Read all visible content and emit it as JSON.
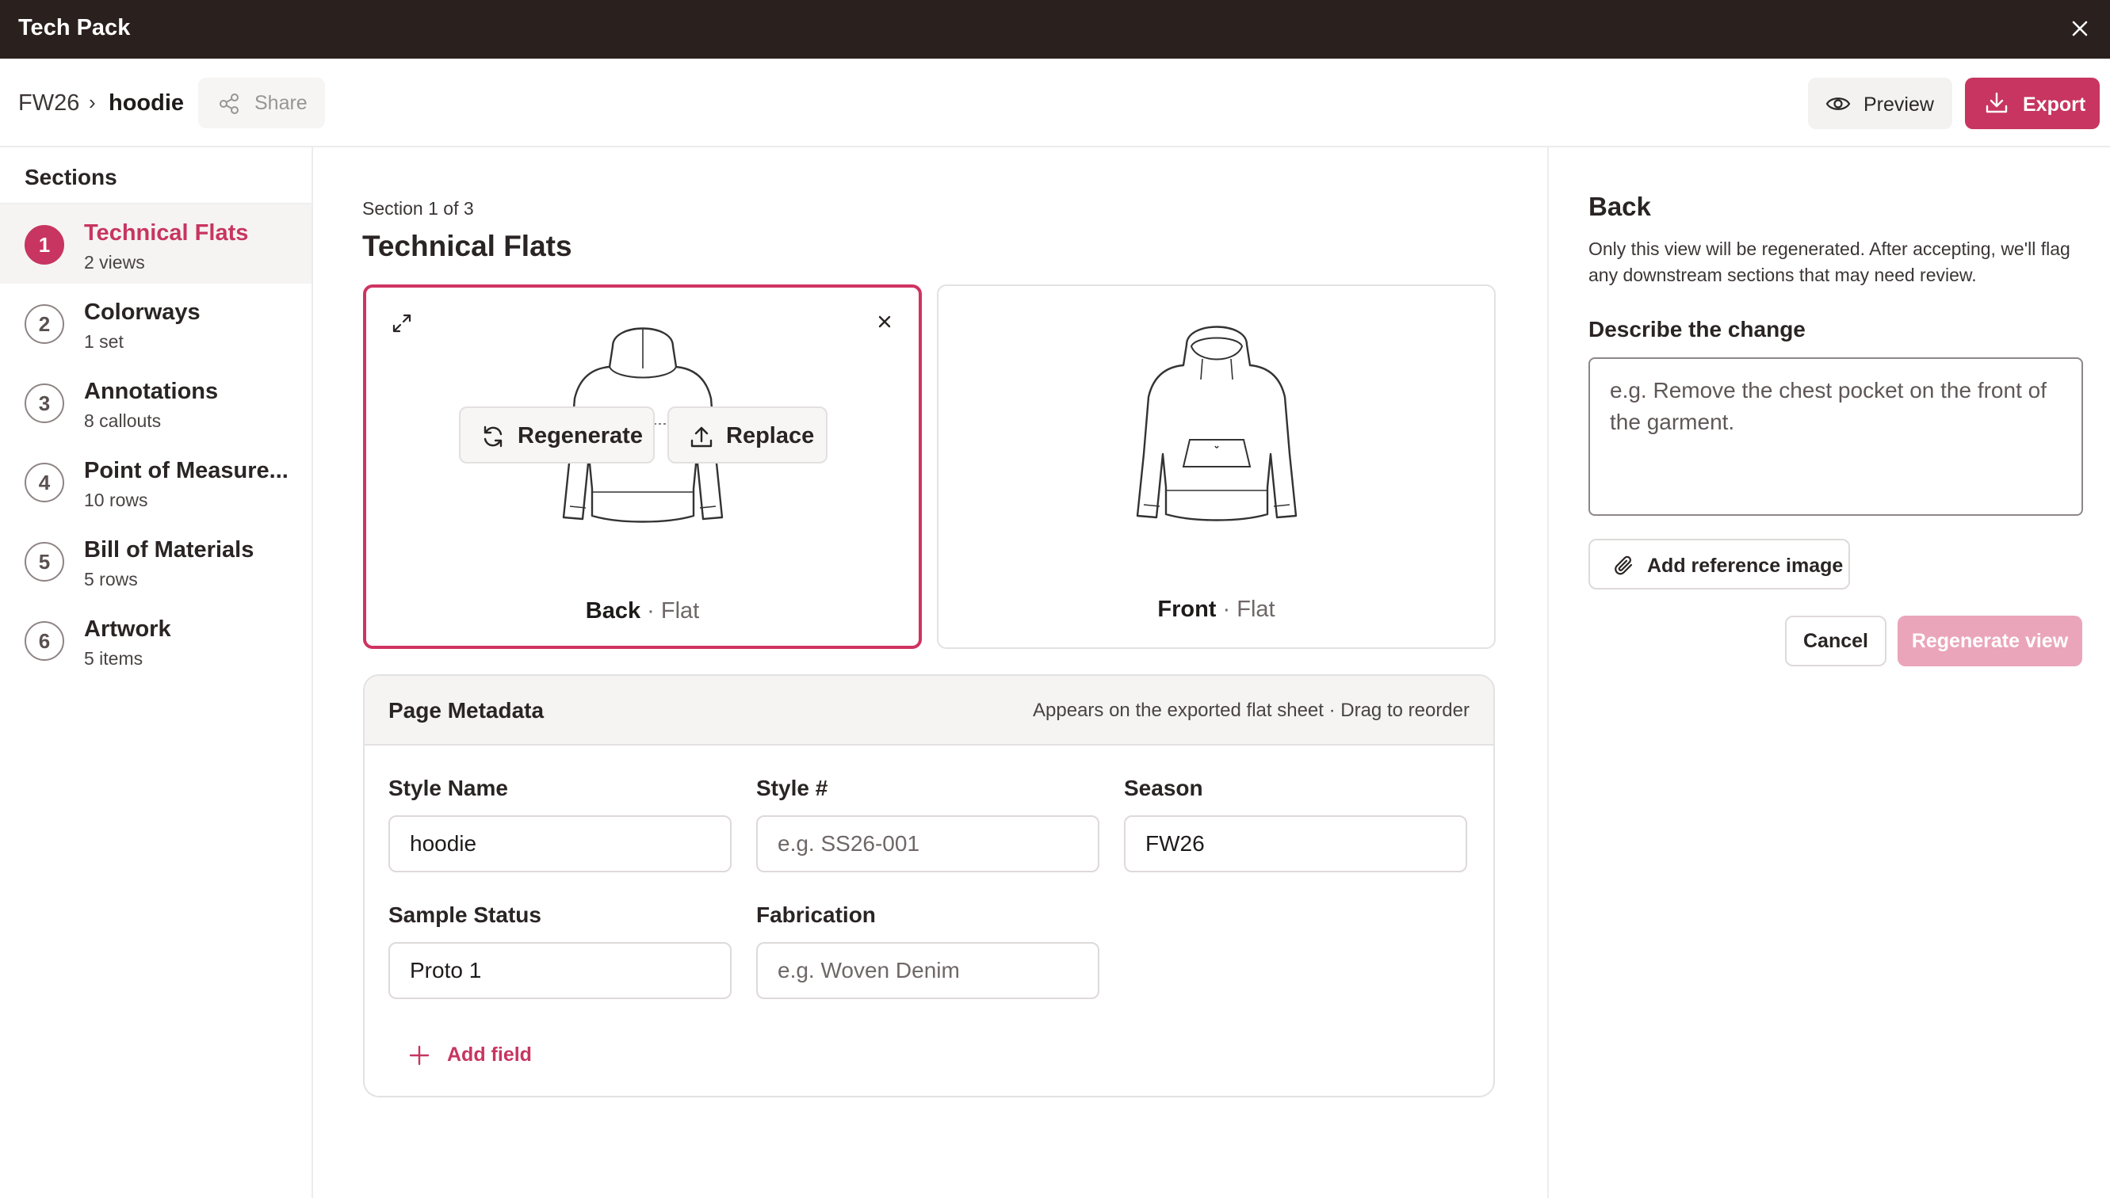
{
  "window": {
    "title": "Tech Pack"
  },
  "breadcrumb": {
    "collection": "FW26",
    "separator": "›",
    "item": "hoodie"
  },
  "toolbar": {
    "share_label": "Share",
    "preview_label": "Preview",
    "export_label": "Export"
  },
  "colors": {
    "accent": "#c73560",
    "accent_disabled": "#eaa5bb",
    "titlebar": "#2a201e"
  },
  "sidebar": {
    "heading": "Sections",
    "items": [
      {
        "num": "1",
        "label": "Technical Flats",
        "sub": "2 views",
        "active": true
      },
      {
        "num": "2",
        "label": "Colorways",
        "sub": "1 set"
      },
      {
        "num": "3",
        "label": "Annotations",
        "sub": "8 callouts"
      },
      {
        "num": "4",
        "label": "Point of Measure...",
        "sub": "10 rows"
      },
      {
        "num": "5",
        "label": "Bill of Materials",
        "sub": "5 rows"
      },
      {
        "num": "6",
        "label": "Artwork",
        "sub": "5 items"
      }
    ]
  },
  "main": {
    "section_count": "Section 1 of 3",
    "title": "Technical Flats",
    "views": [
      {
        "name": "Back",
        "separator": "·",
        "type": "Flat",
        "selected": true,
        "icon": "hoodie-back-flat"
      },
      {
        "name": "Front",
        "separator": "·",
        "type": "Flat",
        "selected": false,
        "icon": "hoodie-front-flat"
      }
    ],
    "overlay": {
      "regenerate_label": "Regenerate",
      "replace_label": "Replace"
    },
    "metadata": {
      "title": "Page Metadata",
      "hint": "Appears on the exported flat sheet · Drag to reorder",
      "fields": [
        {
          "label": "Style Name",
          "value": "hoodie",
          "placeholder": ""
        },
        {
          "label": "Style #",
          "value": "",
          "placeholder": "e.g. SS26-001"
        },
        {
          "label": "Season",
          "value": "FW26",
          "placeholder": ""
        },
        {
          "label": "Sample Status",
          "value": "Proto 1",
          "placeholder": ""
        },
        {
          "label": "Fabrication",
          "value": "",
          "placeholder": "e.g. Woven Denim"
        }
      ],
      "add_field_label": "Add field"
    }
  },
  "panel": {
    "title": "Back",
    "description": "Only this view will be regenerated. After accepting, we'll flag any downstream sections that may need review.",
    "label": "Describe the change",
    "placeholder": "e.g. Remove the chest pocket on the front of the garment.",
    "reference_label": "Add reference image",
    "cancel_label": "Cancel",
    "regenerate_label": "Regenerate view"
  }
}
